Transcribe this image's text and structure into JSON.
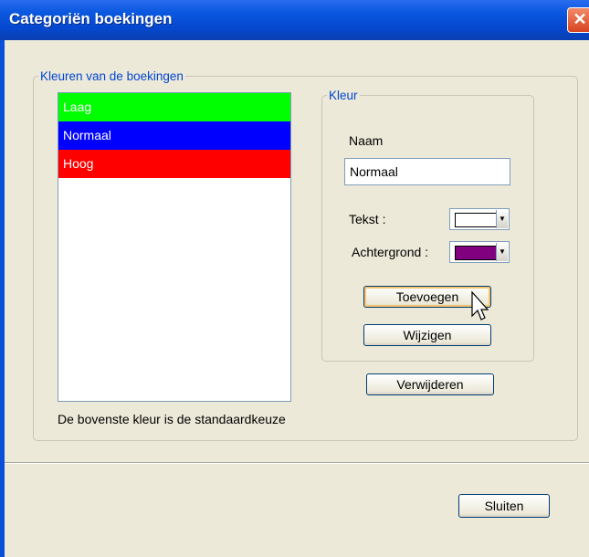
{
  "window": {
    "title": "Categoriën boekingen",
    "close_icon": "close-icon"
  },
  "group_kleuren": {
    "legend": "Kleuren van de boekingen",
    "items": [
      {
        "label": "Laag",
        "color": "#00ff00"
      },
      {
        "label": "Normaal",
        "color": "#0000ff"
      },
      {
        "label": "Hoog",
        "color": "#ff0000"
      }
    ],
    "note": "De bovenste kleur is de standaardkeuze"
  },
  "group_kleur": {
    "legend": "Kleur",
    "naam_label": "Naam",
    "naam_value": "Normaal",
    "tekst_label": "Tekst :",
    "tekst_color": "#ffffff",
    "achtergrond_label": "Achtergrond :",
    "achtergrond_color": "#800080",
    "toevoegen": "Toevoegen",
    "wijzigen": "Wijzigen"
  },
  "verwijderen": "Verwijderen",
  "sluiten": "Sluiten"
}
